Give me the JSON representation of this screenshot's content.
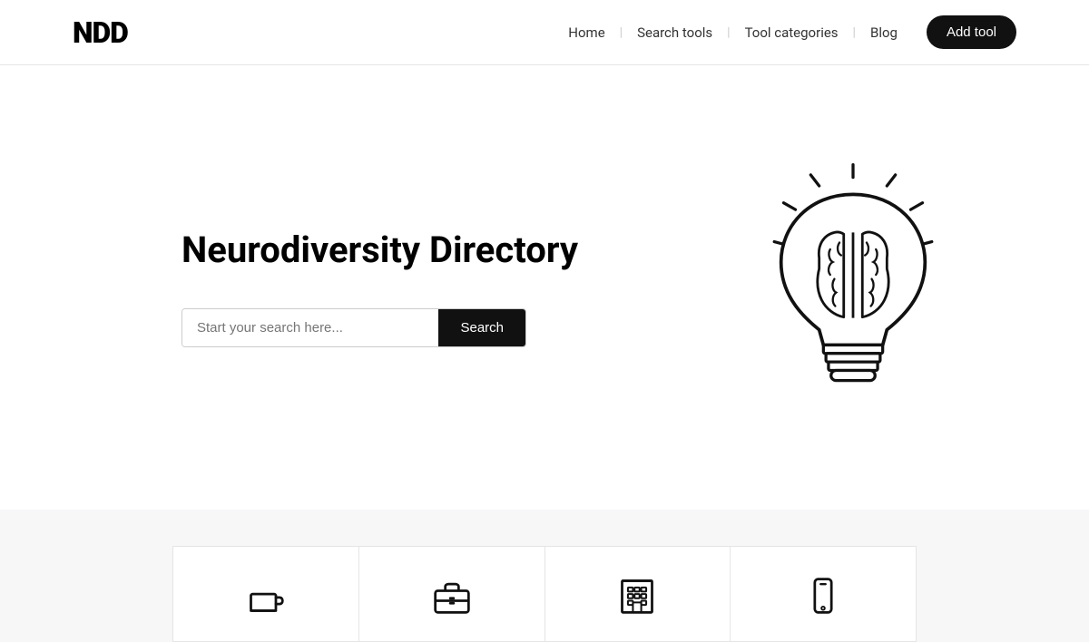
{
  "navbar": {
    "logo": "NDD",
    "links": [
      {
        "label": "Home",
        "name": "home"
      },
      {
        "label": "Search tools",
        "name": "search-tools"
      },
      {
        "label": "Tool categories",
        "name": "tool-categories"
      },
      {
        "label": "Blog",
        "name": "blog"
      }
    ],
    "cta_label": "Add tool"
  },
  "hero": {
    "title": "Neurodiversity Directory",
    "search": {
      "placeholder": "Start your search here...",
      "button_label": "Search"
    }
  },
  "categories": [
    {
      "name": "daily-living",
      "icon": "coffee"
    },
    {
      "name": "work",
      "icon": "briefcase"
    },
    {
      "name": "organization",
      "icon": "building"
    },
    {
      "name": "mobile",
      "icon": "phone"
    }
  ]
}
